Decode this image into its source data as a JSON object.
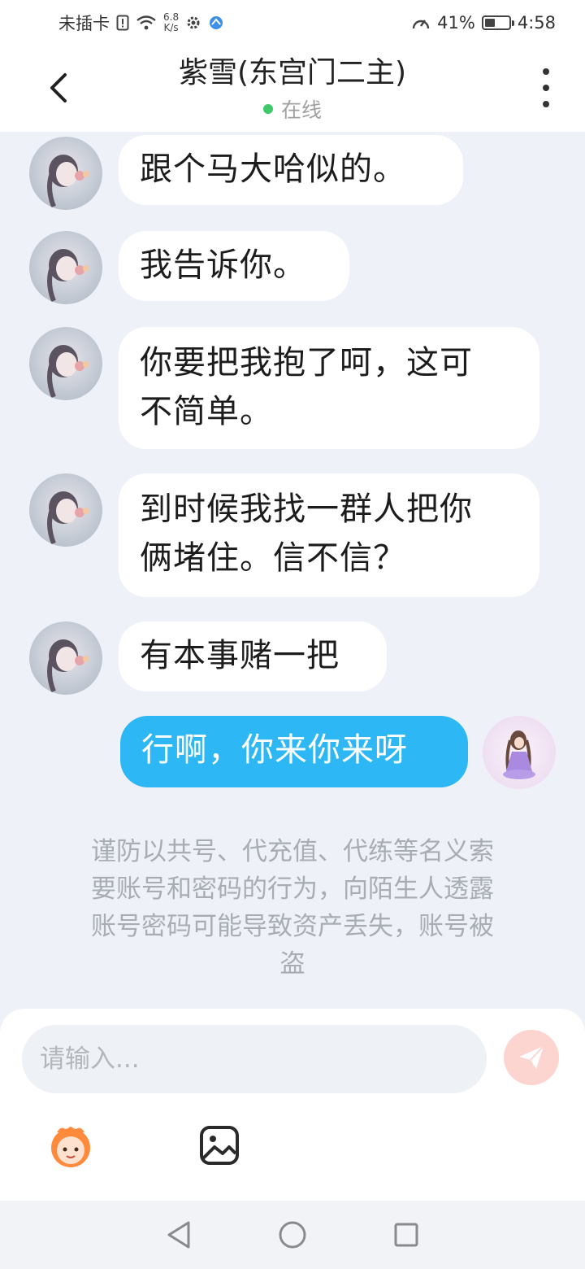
{
  "status_bar": {
    "carrier": "未插卡",
    "net_speed_value": "6.8",
    "net_speed_unit": "K/s",
    "battery": "41%",
    "time": "4:58",
    "battery_level": 0.41
  },
  "header": {
    "title": "紫雪(东宫门二主)",
    "status": "在线",
    "status_color": "#3fc86a"
  },
  "messages": [
    {
      "sender": "other",
      "text": "跟个马大哈似的。"
    },
    {
      "sender": "other",
      "text": "我告诉你。"
    },
    {
      "sender": "other",
      "text_lines": [
        "你要把我抱了呵，这可",
        "不简单。"
      ]
    },
    {
      "sender": "other",
      "text_lines": [
        "到时候我找一群人把你",
        "俩堵住。信不信？"
      ]
    },
    {
      "sender": "other",
      "text": "有本事赌一把"
    },
    {
      "sender": "me",
      "text": "行啊，你来你来呀"
    }
  ],
  "notice": {
    "lines": [
      "谨防以共号、代充值、代练等名义索",
      "要账号和密码的行为，向陌生人透露",
      "账号密码可能导致资产丢失，账号被",
      "盗"
    ]
  },
  "composer": {
    "placeholder": "请输入...",
    "send_icon": "send-icon",
    "emoji_icon": "emoji-icon",
    "image_icon": "image-icon"
  },
  "colors": {
    "accent_bubble": "#2eb7f5",
    "background": "#eef1f7",
    "send_button": "#fdd5d0"
  },
  "nav": [
    "back-triangle-icon",
    "home-circle-icon",
    "recents-square-icon"
  ]
}
